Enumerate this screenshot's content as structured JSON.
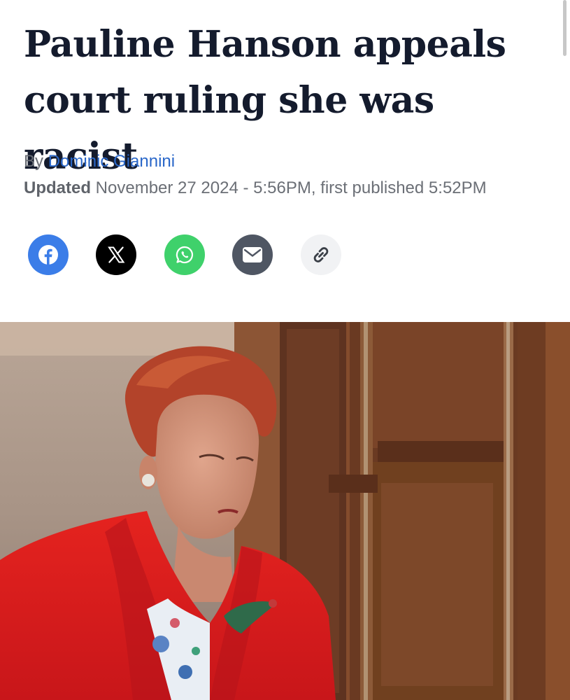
{
  "article": {
    "headline": "Pauline Hanson appeals court ruling she was racist",
    "byline_prefix": "By",
    "author": "Dominic Giannini",
    "updated_label": "Updated",
    "updated_text": "November 27 2024 - 5:56PM, first published 5:52PM"
  },
  "share": {
    "buttons": [
      {
        "icon": "facebook-icon",
        "color": "#3b7de8"
      },
      {
        "icon": "x-icon",
        "color": "#000000"
      },
      {
        "icon": "whatsapp-icon",
        "color": "#3fd16b"
      },
      {
        "icon": "email-icon",
        "color": "#4f5663"
      },
      {
        "icon": "link-icon",
        "color": "#f1f2f4"
      }
    ]
  },
  "colors": {
    "headline": "#141b2d",
    "author_link": "#2a67c9",
    "meta_text": "#6b6f76"
  }
}
